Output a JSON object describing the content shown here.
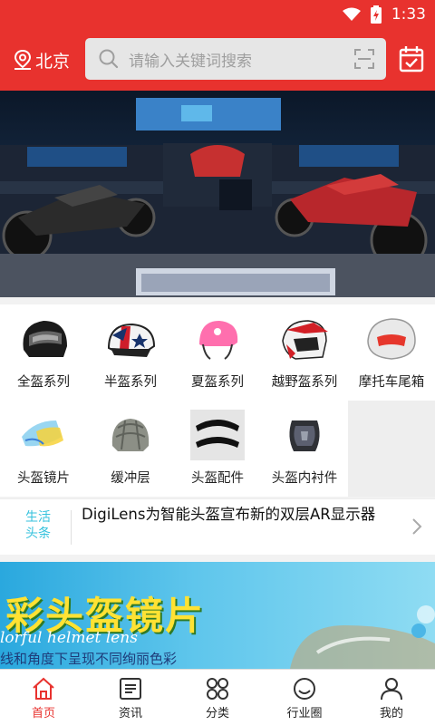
{
  "status_bar": {
    "time": "1:33"
  },
  "header": {
    "city": "北京",
    "search_placeholder": "请输入关键词搜索"
  },
  "categories": [
    {
      "label": "全盔系列"
    },
    {
      "label": "半盔系列"
    },
    {
      "label": "夏盔系列"
    },
    {
      "label": "越野盔系列"
    },
    {
      "label": "摩托车尾箱"
    },
    {
      "label": "头盔镜片"
    },
    {
      "label": "缓冲层"
    },
    {
      "label": "头盔配件"
    },
    {
      "label": "头盔内衬件"
    }
  ],
  "news": {
    "tag_line1": "生活",
    "tag_line2": "头条",
    "headline": "DigiLens为智能头盔宣布新的双层AR显示器"
  },
  "ad": {
    "title": "彩头盔镜片",
    "english": "lorful helmet lens",
    "subtitle": "线和角度下呈现不同绚丽色彩"
  },
  "tabs": [
    {
      "label": "首页",
      "icon": "home-icon",
      "active": true
    },
    {
      "label": "资讯",
      "icon": "news-icon",
      "active": false
    },
    {
      "label": "分类",
      "icon": "category-icon",
      "active": false
    },
    {
      "label": "行业圈",
      "icon": "circle-icon",
      "active": false
    },
    {
      "label": "我的",
      "icon": "profile-icon",
      "active": false
    }
  ],
  "colors": {
    "brand": "#e8322e",
    "tag": "#35c2dd"
  }
}
